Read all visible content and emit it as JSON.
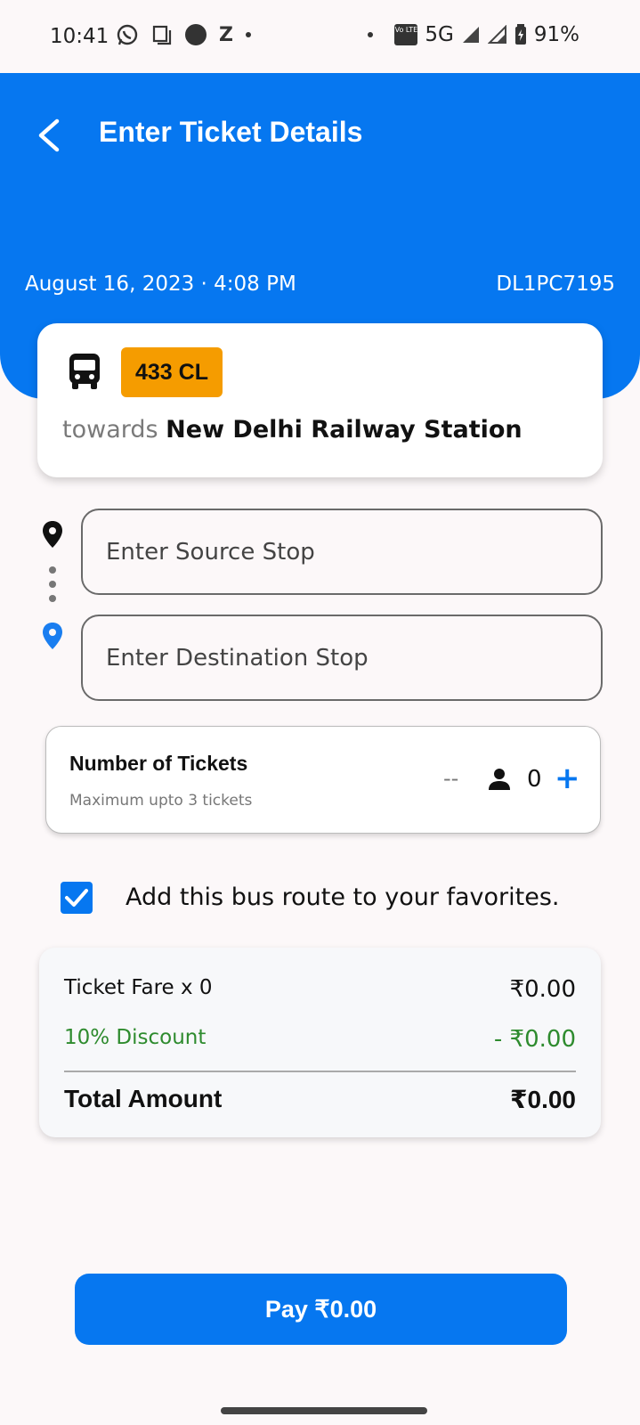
{
  "status_bar": {
    "time": "10:41",
    "network": "5G",
    "battery": "91%",
    "z_glyph": "Z",
    "volte_label": "Vo LTE",
    "icons": [
      "whatsapp-icon",
      "square-icon",
      "circle-icon",
      "z-icon",
      "dot-icon",
      "volte-icon",
      "signal-icon",
      "signal-icon",
      "battery-icon"
    ]
  },
  "header": {
    "title": "Enter Ticket Details",
    "date_time": "August 16, 2023 · 4:08 PM",
    "vehicle_number": "DL1PC7195",
    "color": "#0677f0"
  },
  "route": {
    "number": "433 CL",
    "towards_word": "towards",
    "destination": "New Delhi Railway Station",
    "badge_color": "#f59c00"
  },
  "stops": {
    "source_placeholder": "Enter Source Stop",
    "destination_placeholder": "Enter Destination Stop"
  },
  "tickets": {
    "title": "Number of Tickets",
    "subtitle": "Maximum upto 3 tickets",
    "minus_label": "--",
    "count": "0",
    "plus_label": "+"
  },
  "favorite": {
    "label": "Add this bus route to your favorites.",
    "checked": true
  },
  "fare": {
    "fare_label": "Ticket Fare x 0",
    "fare_value": "₹0.00",
    "discount_label": "10% Discount",
    "discount_value": "- ₹0.00",
    "total_label": "Total Amount",
    "total_value": "₹0.00",
    "discount_color": "#2e8b2e"
  },
  "pay_button": {
    "label": "Pay ₹0.00"
  }
}
